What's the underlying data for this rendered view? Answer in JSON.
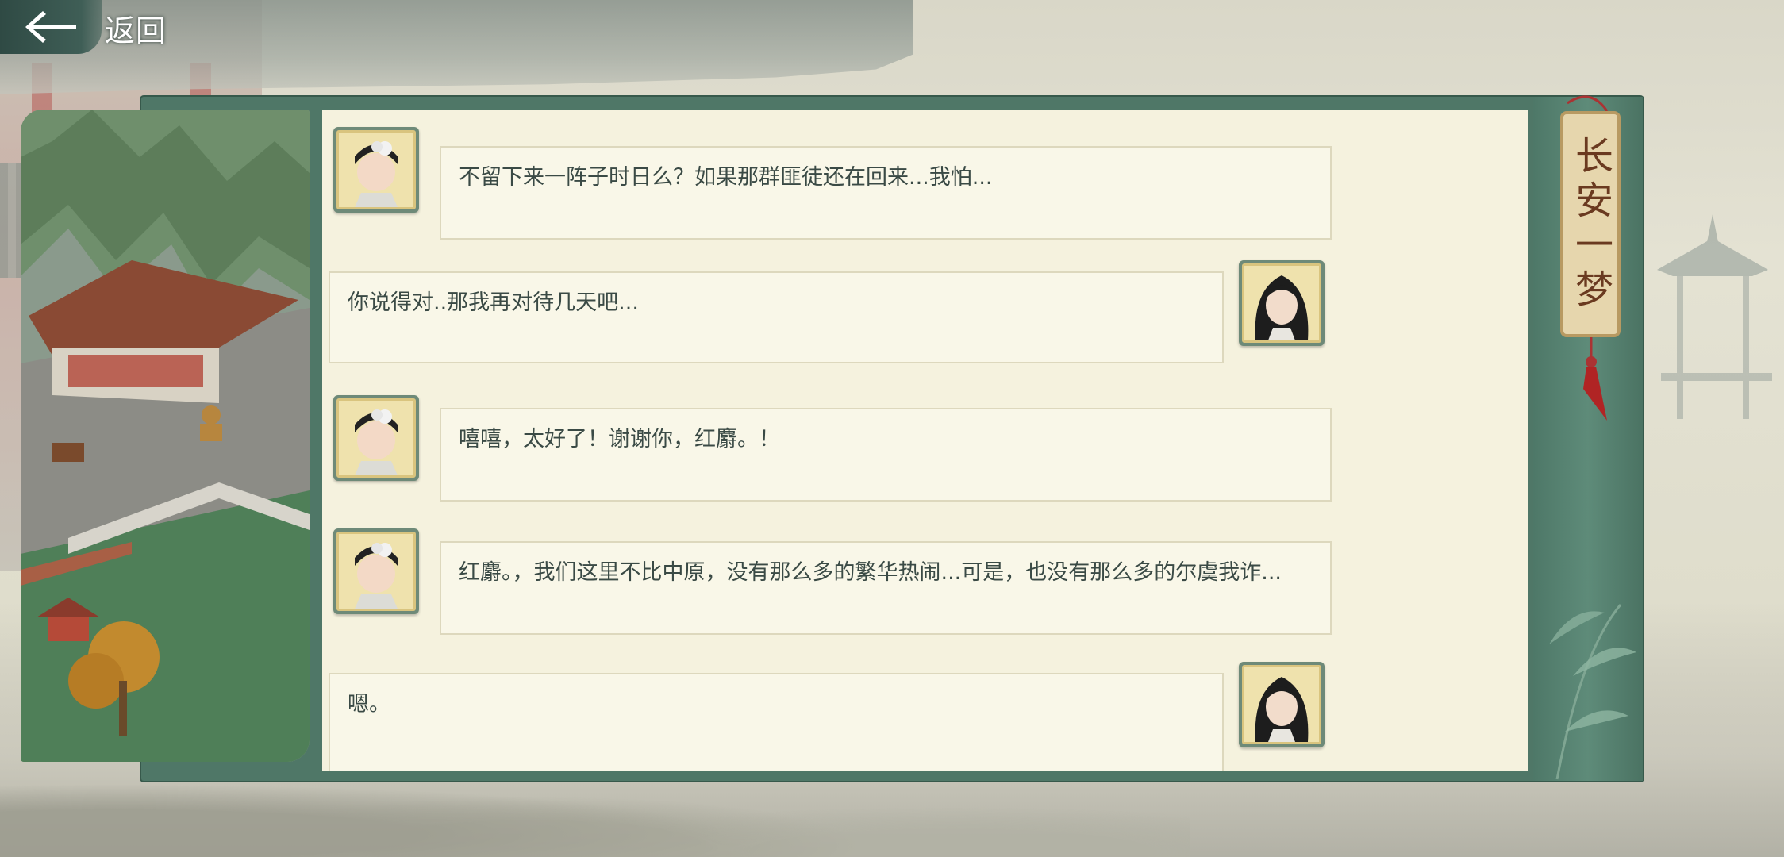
{
  "nav": {
    "back_label": "返回"
  },
  "plaque": {
    "title": "长安一梦"
  },
  "messages": [
    {
      "speaker": "left",
      "avatar": "lady-white-headdress-avatar",
      "text": "不留下来一阵子时日么？如果那群匪徒还在回来...我怕..."
    },
    {
      "speaker": "right",
      "avatar": "woman-long-black-hair-avatar",
      "text": "你说得对..那我再对待几天吧..."
    },
    {
      "speaker": "left",
      "avatar": "lady-white-headdress-avatar",
      "text": "嘻嘻，太好了！谢谢你，红麝。！"
    },
    {
      "speaker": "left",
      "avatar": "lady-white-headdress-avatar",
      "text": "红麝。，我们这里不比中原，没有那么多的繁华热闹...可是，也没有那么多的尔虞我诈..."
    },
    {
      "speaker": "right",
      "avatar": "woman-long-black-hair-avatar",
      "text": "嗯。"
    }
  ],
  "colors": {
    "panel_frame": "#4f7767",
    "chat_bg": "#f5f2de",
    "bubble_bg": "#f9f7e8",
    "text": "#3a4a45",
    "back_button_bg": "#2f4a44"
  }
}
